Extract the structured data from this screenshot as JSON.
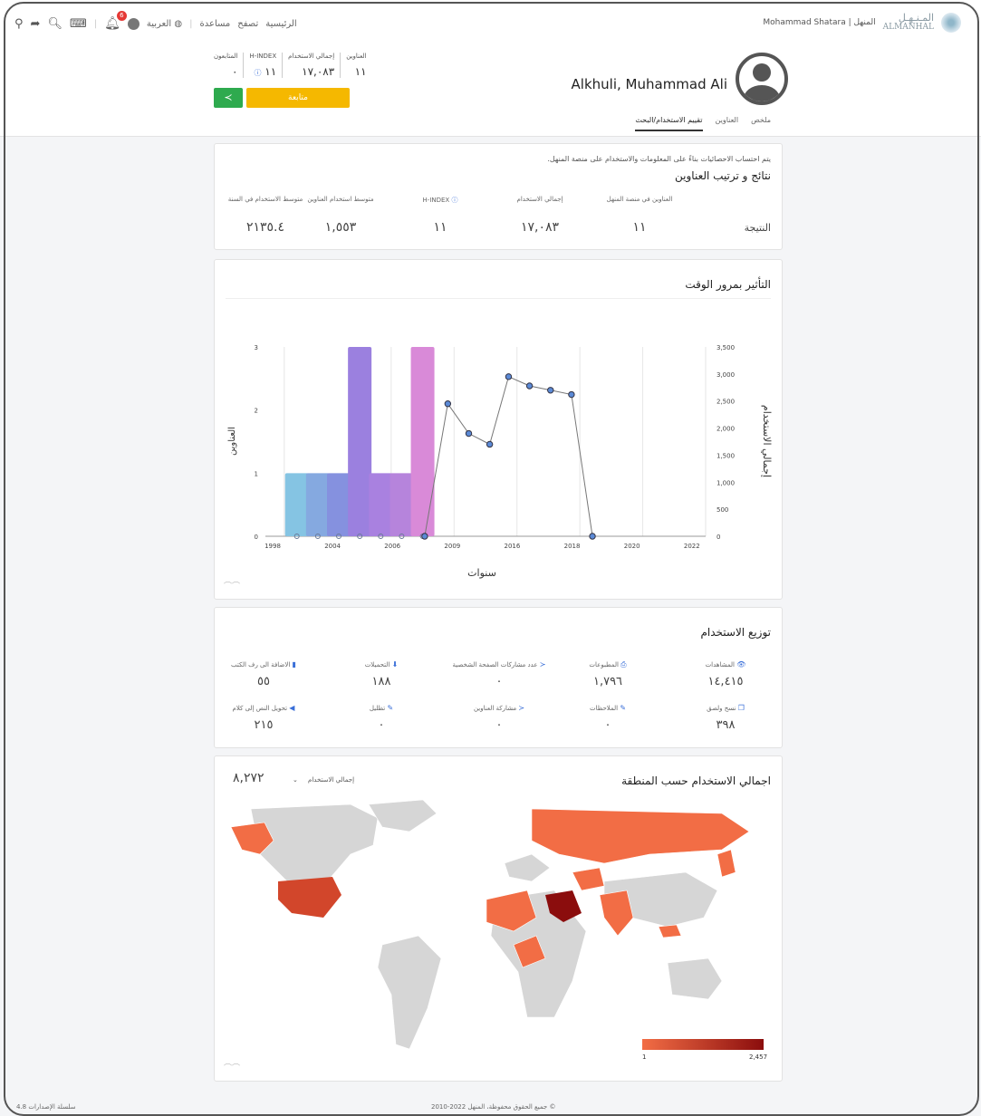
{
  "topbar": {
    "nav": [
      "الرئيسية",
      "تصفح",
      "مساعدة"
    ],
    "language": "العربية",
    "notification_count": "6",
    "user": "Mohammad Shatara | المنهل",
    "logo_ar": "المـنـهـل",
    "logo_en": "ALMANHAL"
  },
  "profile": {
    "name": "Alkhuli, Muhammad Ali",
    "stats": [
      {
        "label": "العناوين",
        "value": "١١"
      },
      {
        "label": "إجمالي الاستخدام",
        "value": "١٧,٠٨٣"
      },
      {
        "label": "H-INDEX",
        "value": "١١"
      },
      {
        "label": "المتابعون",
        "value": "٠"
      }
    ],
    "follow_label": "متابعة",
    "tabs": [
      "ملخص",
      "العناوين",
      "تقييم الاستخدام/البحث"
    ]
  },
  "results": {
    "note": "يتم احتساب الاحصائيات بناءً على المعلومات والاستخدام على منصة المنهل.",
    "title": "نتائج و ترتيب العناوين",
    "row_label": "النتيجة",
    "columns": [
      {
        "head": "العناوين في منصة المنهل",
        "value": "١١"
      },
      {
        "head": "إجمالي الاستخدام",
        "value": "١٧,٠٨٣"
      },
      {
        "head": "H-INDEX",
        "value": "١١"
      },
      {
        "head": "متوسط استخدام العناوين",
        "value": "١,٥٥٣"
      },
      {
        "head": "متوسط الاستخدام في السنة",
        "value": "٢١٣٥.٤"
      }
    ]
  },
  "impact": {
    "title": "التأثير بمرور الوقت"
  },
  "chart_data": {
    "type": "bar",
    "title": "التأثير بمرور الوقت",
    "xlabel": "سنوات",
    "ylabel": "العناوين",
    "y2label": "إجمالي الاستخدام",
    "x_ticks": [
      "1998",
      "2004",
      "2006",
      "2009",
      "2016",
      "2018",
      "2020",
      "2022"
    ],
    "y_ticks": [
      "0",
      "1",
      "2",
      "3"
    ],
    "y2_ticks": [
      "0",
      "500",
      "1,000",
      "1,500",
      "2,000",
      "2,500",
      "3,000",
      "3,500"
    ],
    "ylim": [
      0,
      3
    ],
    "y2lim": [
      0,
      3500
    ],
    "bar_colors": [
      "#85c4e3",
      "#85a9e0",
      "#8591df",
      "#9b80df",
      "#a981e0",
      "#b684dc",
      "#d98ad8"
    ],
    "series": [
      {
        "name": "العناوين",
        "type": "bar",
        "x": [
          "1998",
          "2003",
          "2004",
          "2005",
          "2006",
          "2008",
          "2009"
        ],
        "values": [
          1,
          1,
          1,
          3,
          1,
          1,
          3
        ]
      },
      {
        "name": "إجمالي الاستخدام",
        "type": "line",
        "x": [
          2009.2,
          2010,
          2011,
          2012,
          2013,
          2014,
          2015,
          2016,
          2017
        ],
        "values": [
          0,
          2450,
          1900,
          1700,
          2950,
          2780,
          2700,
          2620,
          0
        ]
      }
    ]
  },
  "usage": {
    "title": "توزيع الاستخدام",
    "items": [
      {
        "label": "المشاهدات",
        "icon": "eye-icon",
        "glyph": "👁",
        "value": "١٤,٤١٥"
      },
      {
        "label": "المطبوعات",
        "icon": "print-icon",
        "glyph": "⎙",
        "value": "١,٧٩٦"
      },
      {
        "label": "عدد مشاركات الصفحة الشخصية",
        "icon": "share-icon",
        "glyph": "≺",
        "value": "٠"
      },
      {
        "label": "التحميلات",
        "icon": "download-icon",
        "glyph": "⬇",
        "value": "١٨٨"
      },
      {
        "label": "الاضافة الى رف الكتب",
        "icon": "book-icon",
        "glyph": "▮",
        "value": "٥٥"
      },
      {
        "label": "نسخ ولصق",
        "icon": "copy-icon",
        "glyph": "❐",
        "value": "٣٩٨"
      },
      {
        "label": "الملاحظات",
        "icon": "pencil-icon",
        "glyph": "✎",
        "value": "٠"
      },
      {
        "label": "مشاركة العناوين",
        "icon": "share-icon",
        "glyph": "≺",
        "value": "٠"
      },
      {
        "label": "تظليل",
        "icon": "highlight-icon",
        "glyph": "✎",
        "value": "٠"
      },
      {
        "label": "تحويل النص إلى كلام",
        "icon": "speaker-icon",
        "glyph": "◀",
        "value": "٢١٥"
      }
    ]
  },
  "map": {
    "title": "اجمالي الاستخدام حسب المنطقة",
    "dropdown": "إجمالي الاستخدام",
    "total": "٨,٢٧٢",
    "legend_min": "1",
    "legend_max": "2,457",
    "land_color": "#d6d6d6",
    "low_color": "#f26d45",
    "high_color": "#8b0d0d"
  },
  "footer": {
    "copyright": "جميع الحقوق محفوظة، المنهل 2022-2010 ©",
    "version": "سلسلة الإصدارات 4.8"
  }
}
